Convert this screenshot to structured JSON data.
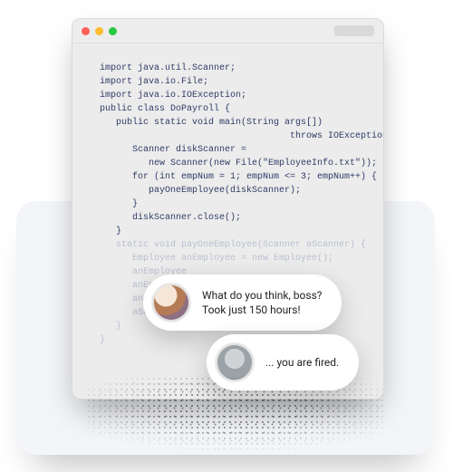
{
  "window": {
    "traffic_colors": [
      "#ff5f57",
      "#febc2e",
      "#28c840"
    ]
  },
  "code": {
    "lines": [
      "import java.util.Scanner;",
      "import java.io.File;",
      "import java.io.IOException;",
      "public class DoPayroll {",
      "   public static void main(String args[])",
      "                                   throws IOException {",
      "      Scanner diskScanner =",
      "         new Scanner(new File(\"EmployeeInfo.txt\"));",
      "      for (int empNum = 1; empNum <= 3; empNum++) {",
      "         payOneEmployee(diskScanner);",
      "      }",
      "      diskScanner.close();",
      "   }"
    ],
    "faded_lines": [
      "   static void payOneEmployee(Scanner aScanner) {",
      "      Employee anEmployee = new Employee();",
      "      anEmployee",
      "      anEmployee",
      "      anEmployee",
      "      aScanner.ne",
      "   }",
      "}"
    ]
  },
  "chat": {
    "bubble1": {
      "speaker": "developer",
      "text": "What do you think, boss?\nTook just 150 hours!"
    },
    "bubble2": {
      "speaker": "boss",
      "text": "... you are fired."
    }
  }
}
